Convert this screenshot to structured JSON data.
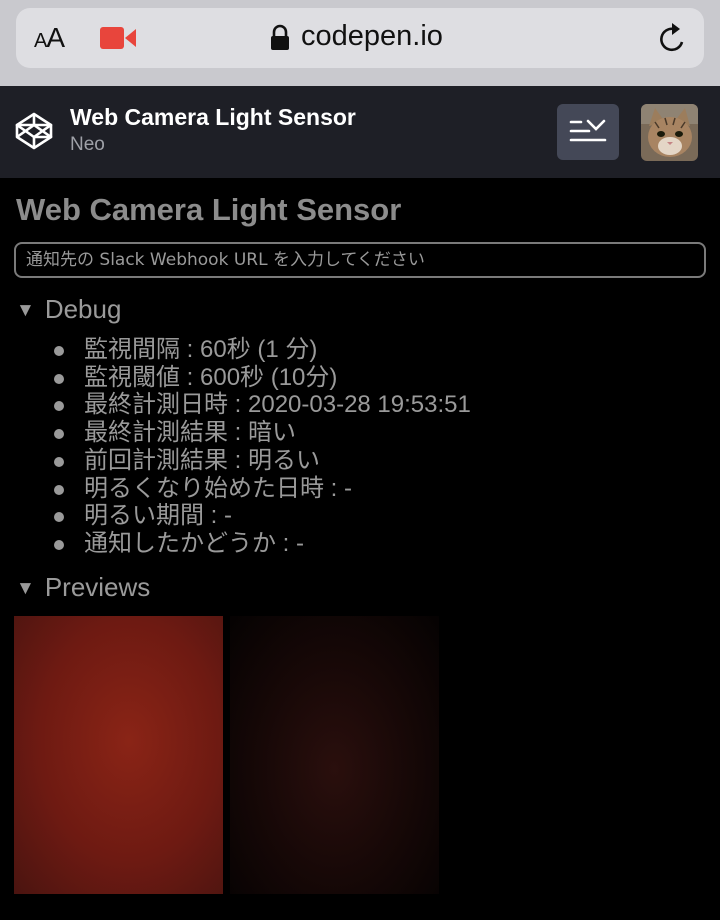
{
  "browser": {
    "text_size_label": "AA",
    "url": "codepen.io",
    "accent_camera_color": "#e8453c"
  },
  "header": {
    "title": "Web Camera Light Sensor",
    "author": "Neo"
  },
  "main": {
    "page_title": "Web Camera Light Sensor",
    "webhook_placeholder": "通知先の Slack Webhook URL を入力してください",
    "debug_label": "Debug",
    "debug_items": [
      "監視間隔 : 60秒 (1 分)",
      "監視閾値 : 600秒 (10分)",
      "最終計測日時 : 2020-03-28 19:53:51",
      "最終計測結果 : 暗い",
      "前回計測結果 : 明るい",
      "明るくなり始めた日時 : -",
      "明るい期間 : -",
      "通知したかどうか : -"
    ],
    "previews_label": "Previews"
  }
}
